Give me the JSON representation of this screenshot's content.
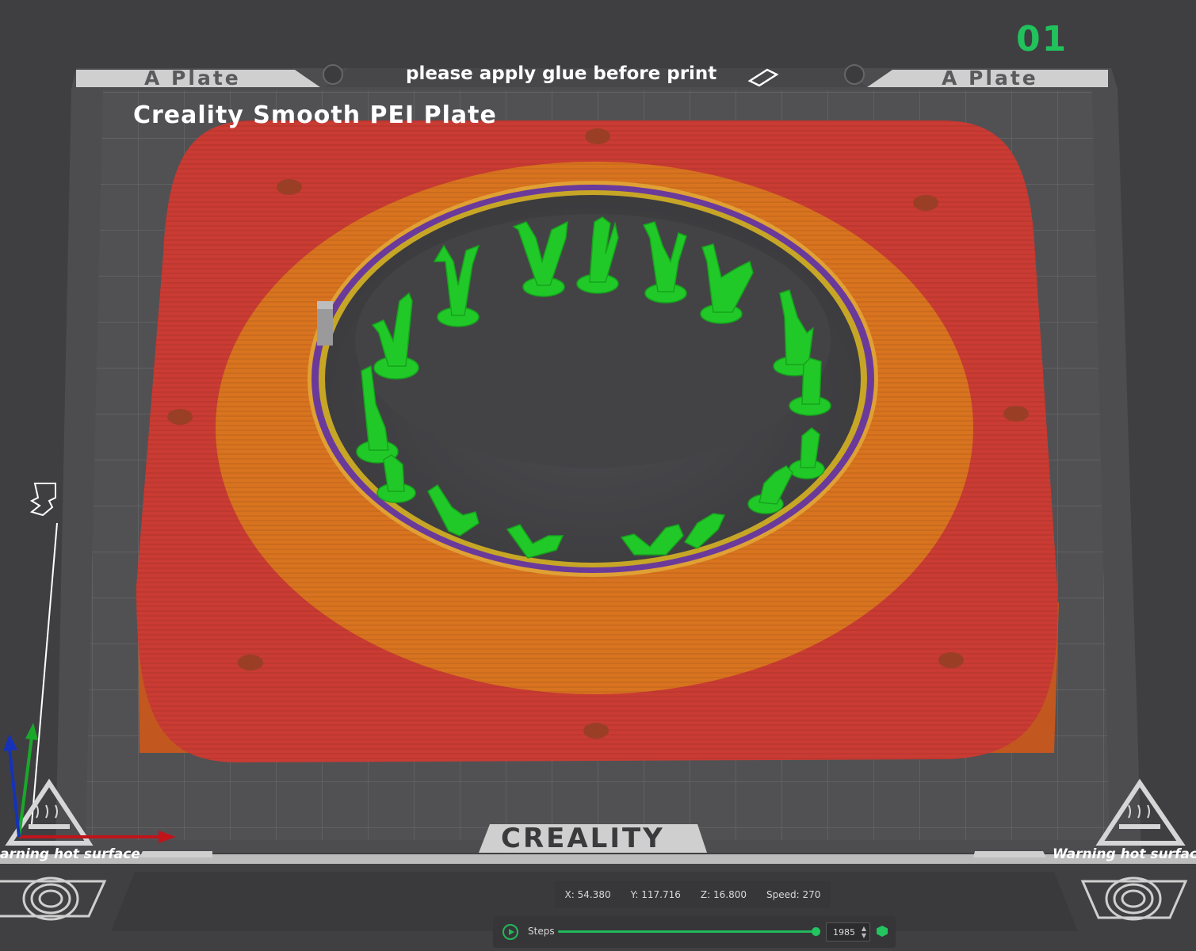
{
  "plate": {
    "number": "01",
    "tab_left": "A Plate",
    "tab_right": "A Plate",
    "glue_notice": "please apply glue before print",
    "plate_name": "Creality Smooth PEI Plate",
    "warning_left": "arning hot surface",
    "warning_right": "Warning hot surface",
    "brand": "CREALITY"
  },
  "icons": {
    "eraser": "eraser-icon",
    "heat_warning": "hot-surface-warning-icon",
    "fingerprint": "fingerprint-icon",
    "axes": "xyz-axes-icon",
    "play": "play-icon",
    "cube": "cube-icon",
    "spinner": "spinner-arrows-icon"
  },
  "colors": {
    "model_red": "#c93b33",
    "model_orange": "#d8731f",
    "supports_green": "#21c928",
    "accent_green": "#22b85a",
    "bed": "#505053"
  },
  "status": {
    "x": "X: 54.380",
    "y": "Y: 117.716",
    "z": "Z: 16.800",
    "speed": "Speed: 270"
  },
  "preview": {
    "steps_label": "Steps",
    "steps_value": "1985",
    "steps_fraction": 1.0
  }
}
